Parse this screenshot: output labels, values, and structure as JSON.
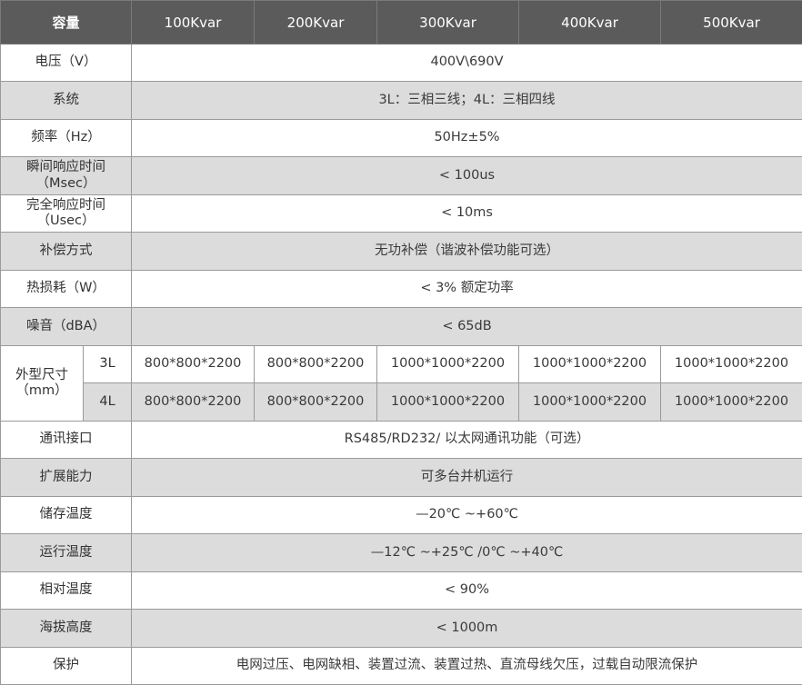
{
  "header": {
    "capacity_label": "容量",
    "columns": [
      "100Kvar",
      "200Kvar",
      "300Kvar",
      "400Kvar",
      "500Kvar"
    ]
  },
  "rows": {
    "voltage": {
      "label": "电压（V）",
      "value": "400V\\690V"
    },
    "system": {
      "label": "系统",
      "value": "3L：三相三线；4L：三相四线"
    },
    "frequency": {
      "label": "频率（Hz）",
      "value": "50Hz±5%"
    },
    "instant_response": {
      "label_line1": "瞬间响应时间",
      "label_line2": "（Msec）",
      "value": "< 100us"
    },
    "full_response": {
      "label_line1": "完全响应时间",
      "label_line2": "（Usec）",
      "value": "< 10ms"
    },
    "compensation": {
      "label": "补偿方式",
      "value": "无功补偿（谐波补偿功能可选）"
    },
    "heat_loss": {
      "label": "热损耗（W）",
      "value": "< 3% 额定功率"
    },
    "noise": {
      "label": "噪音（dBA）",
      "value": "< 65dB"
    },
    "dimensions": {
      "label_line1": "外型尺寸",
      "label_line2": "（mm）",
      "sub_3l": "3L",
      "sub_4l": "4L",
      "values_3l": [
        "800*800*2200",
        "800*800*2200",
        "1000*1000*2200",
        "1000*1000*2200",
        "1000*1000*2200"
      ],
      "values_4l": [
        "800*800*2200",
        "800*800*2200",
        "1000*1000*2200",
        "1000*1000*2200",
        "1000*1000*2200"
      ]
    },
    "communication": {
      "label": "通讯接口",
      "value": "RS485/RD232/ 以太网通讯功能（可选）"
    },
    "expansion": {
      "label": "扩展能力",
      "value": "可多台并机运行"
    },
    "storage_temp": {
      "label": "储存温度",
      "value": "—20℃ ~+60℃"
    },
    "operating_temp": {
      "label": "运行温度",
      "value": "—12℃ ~+25℃ /0℃ ~+40℃"
    },
    "humidity": {
      "label": "相对温度",
      "value": "< 90%"
    },
    "altitude": {
      "label": "海拔高度",
      "value": "< 1000m"
    },
    "protection": {
      "label": "保护",
      "value": "电网过压、电网缺相、装置过流、装置过热、直流母线欠压，过载自动限流保护"
    }
  },
  "colors": {
    "header_bg": "#5b5b5b",
    "header_text": "#ffffff",
    "row_alt_bg": "#dcdcdc",
    "row_bg": "#ffffff",
    "border": "#9a9a9a",
    "text": "#3a3a3a"
  }
}
